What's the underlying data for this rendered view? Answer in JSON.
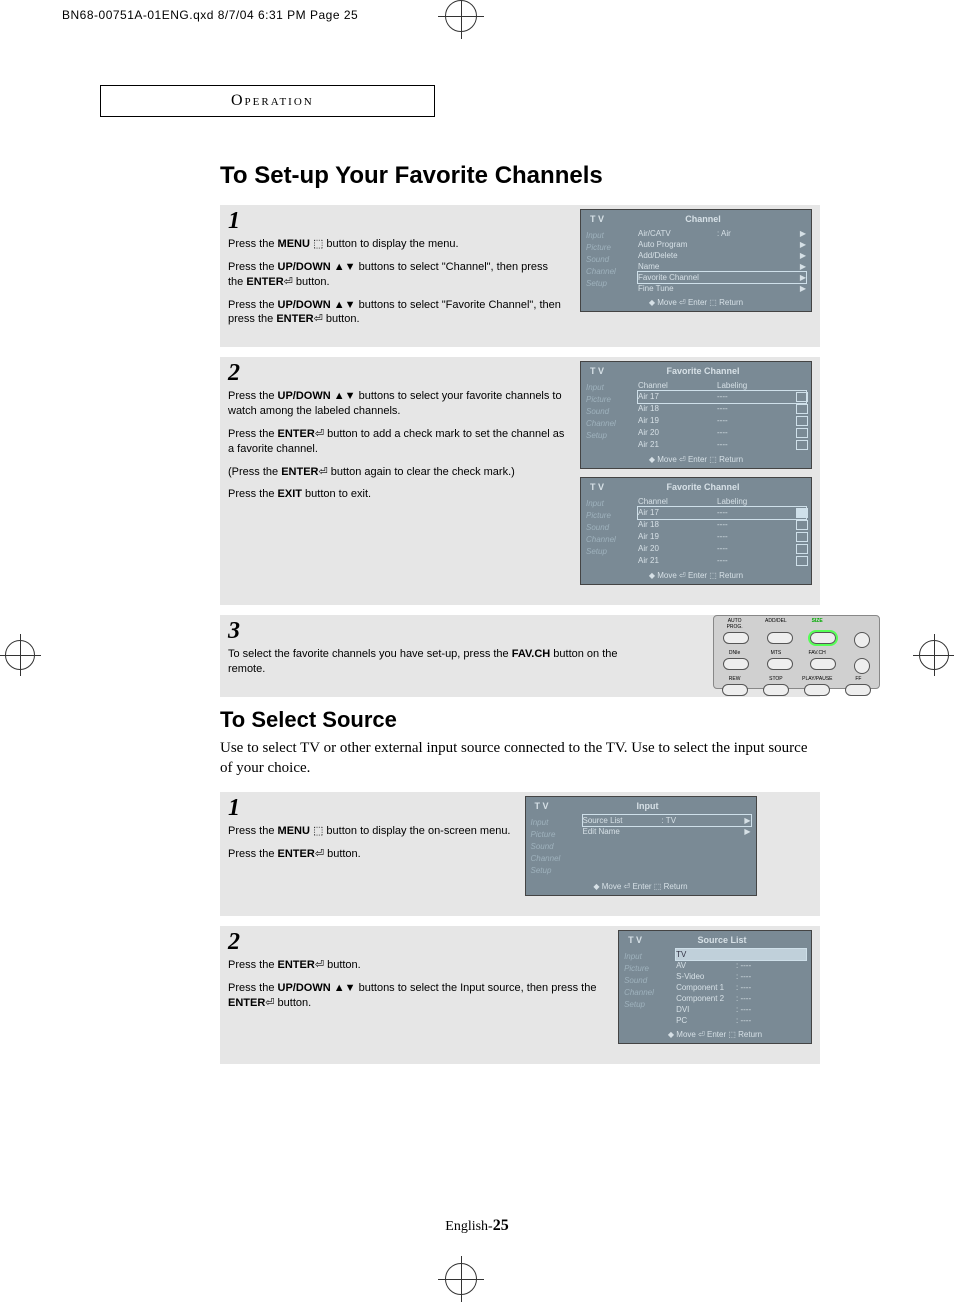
{
  "header_line": "BN68-00751A-01ENG.qxd  8/7/04 6:31 PM  Page 25",
  "operation_label": "Operation",
  "title1": "To Set-up Your Favorite Channels",
  "step1": {
    "num": "1",
    "p1a": "Press the ",
    "p1b": "MENU",
    "p1c": " button to display the menu.",
    "p2a": "Press the ",
    "p2b": "UP/DOWN",
    "p2c": " buttons to select \"Channel\", then press the ",
    "p2d": "ENTER",
    "p2e": " button.",
    "p3a": "Press the ",
    "p3b": "UP/DOWN",
    "p3c": " buttons to select \"Favorite Channel\", then press the ",
    "p3d": "ENTER",
    "p3e": " button."
  },
  "osd1": {
    "tv": "T V",
    "title": "Channel",
    "side": [
      "Input",
      "Picture",
      "Sound",
      "Channel",
      "Setup"
    ],
    "rows": [
      {
        "l": "Air/CATV",
        "m": ":  Air",
        "r": "▶"
      },
      {
        "l": "Auto Program",
        "m": "",
        "r": "▶"
      },
      {
        "l": "Add/Delete",
        "m": "",
        "r": "▶"
      },
      {
        "l": "Name",
        "m": "",
        "r": "▶"
      },
      {
        "l": "Favorite  Channel",
        "m": "",
        "r": "▶",
        "hl": true
      },
      {
        "l": "Fine Tune",
        "m": "",
        "r": "▶"
      }
    ],
    "foot": "◆ Move      ⏎ Enter      ⬚ Return"
  },
  "step2": {
    "num": "2",
    "p1a": "Press the ",
    "p1b": "UP/DOWN",
    "p1c": " buttons to select your favorite channels to watch among the labeled channels.",
    "p2a": "Press the ",
    "p2b": "ENTER",
    "p2c": " button to add a check mark to set the channel as a favorite channel.",
    "p3a": "(Press the ",
    "p3b": "ENTER",
    "p3c": " button again to clear the check mark.)",
    "p4a": "Press the ",
    "p4b": "EXIT",
    "p4c": " button to exit."
  },
  "osd2a": {
    "tv": "T V",
    "title": "Favorite Channel",
    "side": [
      "Input",
      "Picture",
      "Sound",
      "Channel",
      "Setup"
    ],
    "head": {
      "l": "Channel",
      "m": "Labeling"
    },
    "rows": [
      {
        "l": "Air  17",
        "m": "----",
        "chk": false,
        "hl": true
      },
      {
        "l": "Air  18",
        "m": "----",
        "chk": false
      },
      {
        "l": "Air  19",
        "m": "----",
        "chk": false
      },
      {
        "l": "Air  20",
        "m": "----",
        "chk": false
      },
      {
        "l": "Air  21",
        "m": "----",
        "chk": false
      }
    ],
    "foot": "◆ Move      ⏎ Enter      ⬚ Return"
  },
  "osd2b": {
    "tv": "T V",
    "title": "Favorite Channel",
    "side": [
      "Input",
      "Picture",
      "Sound",
      "Channel",
      "Setup"
    ],
    "head": {
      "l": "Channel",
      "m": "Labeling"
    },
    "rows": [
      {
        "l": "Air  17",
        "m": "----",
        "chk": true,
        "hl": true
      },
      {
        "l": "Air  18",
        "m": "----",
        "chk": false
      },
      {
        "l": "Air  19",
        "m": "----",
        "chk": false
      },
      {
        "l": "Air  20",
        "m": "----",
        "chk": false
      },
      {
        "l": "Air  21",
        "m": "----",
        "chk": false
      }
    ],
    "foot": "◆ Move      ⏎ Enter      ⬚ Return"
  },
  "step3": {
    "num": "3",
    "p1a": "To select the favorite channels you have set-up, press the ",
    "p1b": "FAV.CH",
    "p1c": " button on the remote."
  },
  "remote": {
    "row1": [
      "AUTO PROG.",
      "ADD/DEL",
      "SIZE",
      ""
    ],
    "row2": [
      "DNIe",
      "MTS",
      "FAV.CH",
      ""
    ],
    "row3": [
      "REW",
      "STOP",
      "PLAY/PAUSE",
      "FF"
    ]
  },
  "title2": "To Select Source",
  "desc": "Use to select TV or other external input source connected to the TV. Use to select the input source of your choice.",
  "step4": {
    "num": "1",
    "p1a": "Press the ",
    "p1b": "MENU",
    "p1c": " button to display the on-screen menu.",
    "p2a": "Press the ",
    "p2b": "ENTER",
    "p2c": " button."
  },
  "osd4": {
    "tv": "T V",
    "title": "Input",
    "side": [
      "Input",
      "Picture",
      "Sound",
      "Channel",
      "Setup"
    ],
    "rows": [
      {
        "l": "Source List",
        "m": ":    TV",
        "r": "▶",
        "hl": true
      },
      {
        "l": "Edit Name",
        "m": "",
        "r": "▶"
      }
    ],
    "foot": "◆ Move      ⏎ Enter      ⬚ Return"
  },
  "step5": {
    "num": "2",
    "p1a": "Press the ",
    "p1b": "ENTER",
    "p1c": " button.",
    "p2a": "Press the ",
    "p2b": "UP/DOWN",
    "p2c": " buttons to select the Input source, then press the ",
    "p2d": "ENTER",
    "p2e": " button."
  },
  "osd5": {
    "tv": "T V",
    "title": "Source List",
    "side": [
      "Input",
      "Picture",
      "Sound",
      "Channel",
      "Setup"
    ],
    "rows": [
      {
        "l": "TV",
        "m": "",
        "r": "",
        "hl": true
      },
      {
        "l": "AV",
        "m": ":    ----",
        "r": ""
      },
      {
        "l": "S-Video",
        "m": ":    ----",
        "r": ""
      },
      {
        "l": "Component 1",
        "m": ":    ----",
        "r": ""
      },
      {
        "l": "Component 2",
        "m": ":    ----",
        "r": ""
      },
      {
        "l": "DVI",
        "m": ":    ----",
        "r": ""
      },
      {
        "l": "PC",
        "m": ":    ----",
        "r": ""
      }
    ],
    "foot": "◆ Move      ⏎ Enter      ⬚ Return"
  },
  "footer_a": "English-",
  "footer_b": "25"
}
